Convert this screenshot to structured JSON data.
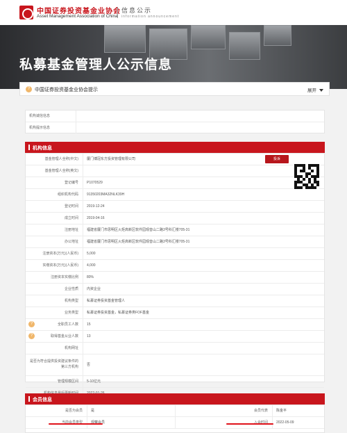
{
  "header": {
    "org_cn": "中国证券投资基金业协会",
    "org_en": "Asset Management Association of China",
    "sub_cn": "信息公示",
    "sub_en": "information announcement"
  },
  "banner": {
    "title": "私募基金管理人公示信息"
  },
  "notice": {
    "text": "中国证券投资基金业协会提示",
    "expand": "展开"
  },
  "integrity": {
    "rows": [
      {
        "label": "机构诚信信息",
        "value": ""
      },
      {
        "label": "机构提示信息",
        "value": ""
      }
    ]
  },
  "org_info": {
    "title": "机构信息",
    "report_label": "投诉",
    "rows": [
      {
        "label": "基金管理人全称(中文)",
        "value": "厦门博冠东方投资管理有限公司",
        "help": false
      },
      {
        "label": "基金管理人全称(英文)",
        "value": "",
        "help": false
      },
      {
        "label": "登记编号",
        "value": "P1070529",
        "help": false
      },
      {
        "label": "组织机构代码",
        "value": "91350203MA32NLK39H",
        "help": false
      },
      {
        "label": "登记时间",
        "value": "2019-12-24",
        "help": false
      },
      {
        "label": "成立时间",
        "value": "2019-04-16",
        "help": false
      },
      {
        "label": "注册地址",
        "value": "福建省厦门市思明区火炬高新区软件园观音山二路3号科汇楼705-31",
        "help": false
      },
      {
        "label": "办公地址",
        "value": "福建省厦门市思明区火炬高新区软件园观音山二路3号科汇楼705-31",
        "help": false
      },
      {
        "label": "注册资本(万元)(人民币)",
        "value": "5,000",
        "help": false
      },
      {
        "label": "实缴资本(万元)(人民币)",
        "value": "4,000",
        "help": false
      },
      {
        "label": "注册资本实缴比例",
        "value": "80%",
        "help": false
      },
      {
        "label": "企业性质",
        "value": "内资企业",
        "help": false
      },
      {
        "label": "机构类型",
        "value": "私募证券投资基金管理人",
        "help": false
      },
      {
        "label": "业务类型",
        "value": "私募证券投资基金，私募证券类FOF基金",
        "help": false
      },
      {
        "label": "全职员工人数",
        "value": "15",
        "help": true
      },
      {
        "label": "取得基金从业人数",
        "value": "13",
        "help": true
      },
      {
        "label": "机构网址",
        "value": "",
        "help": false
      },
      {
        "label": "是否为符合提供投资建议条件的第三方机构",
        "value": "否",
        "help": false
      },
      {
        "label": "管理规模区间",
        "value": "5-10亿元",
        "help": false
      },
      {
        "label": "机构信息最后更新时间",
        "value": "2022-01-26",
        "help": false
      }
    ]
  },
  "member_info": {
    "title": "会员信息",
    "left": [
      {
        "label": "是否为会员",
        "value": "是"
      },
      {
        "label": "当前会员类型",
        "value": "观察会员"
      }
    ],
    "right": [
      {
        "label": "会员代表",
        "value": "陈金平"
      },
      {
        "label": "入会时间",
        "value": "2022-05-09"
      }
    ]
  },
  "colors": {
    "brand_red": "#c8161d",
    "highlight_red": "#e0121a",
    "help_orange": "#f0b76b"
  }
}
